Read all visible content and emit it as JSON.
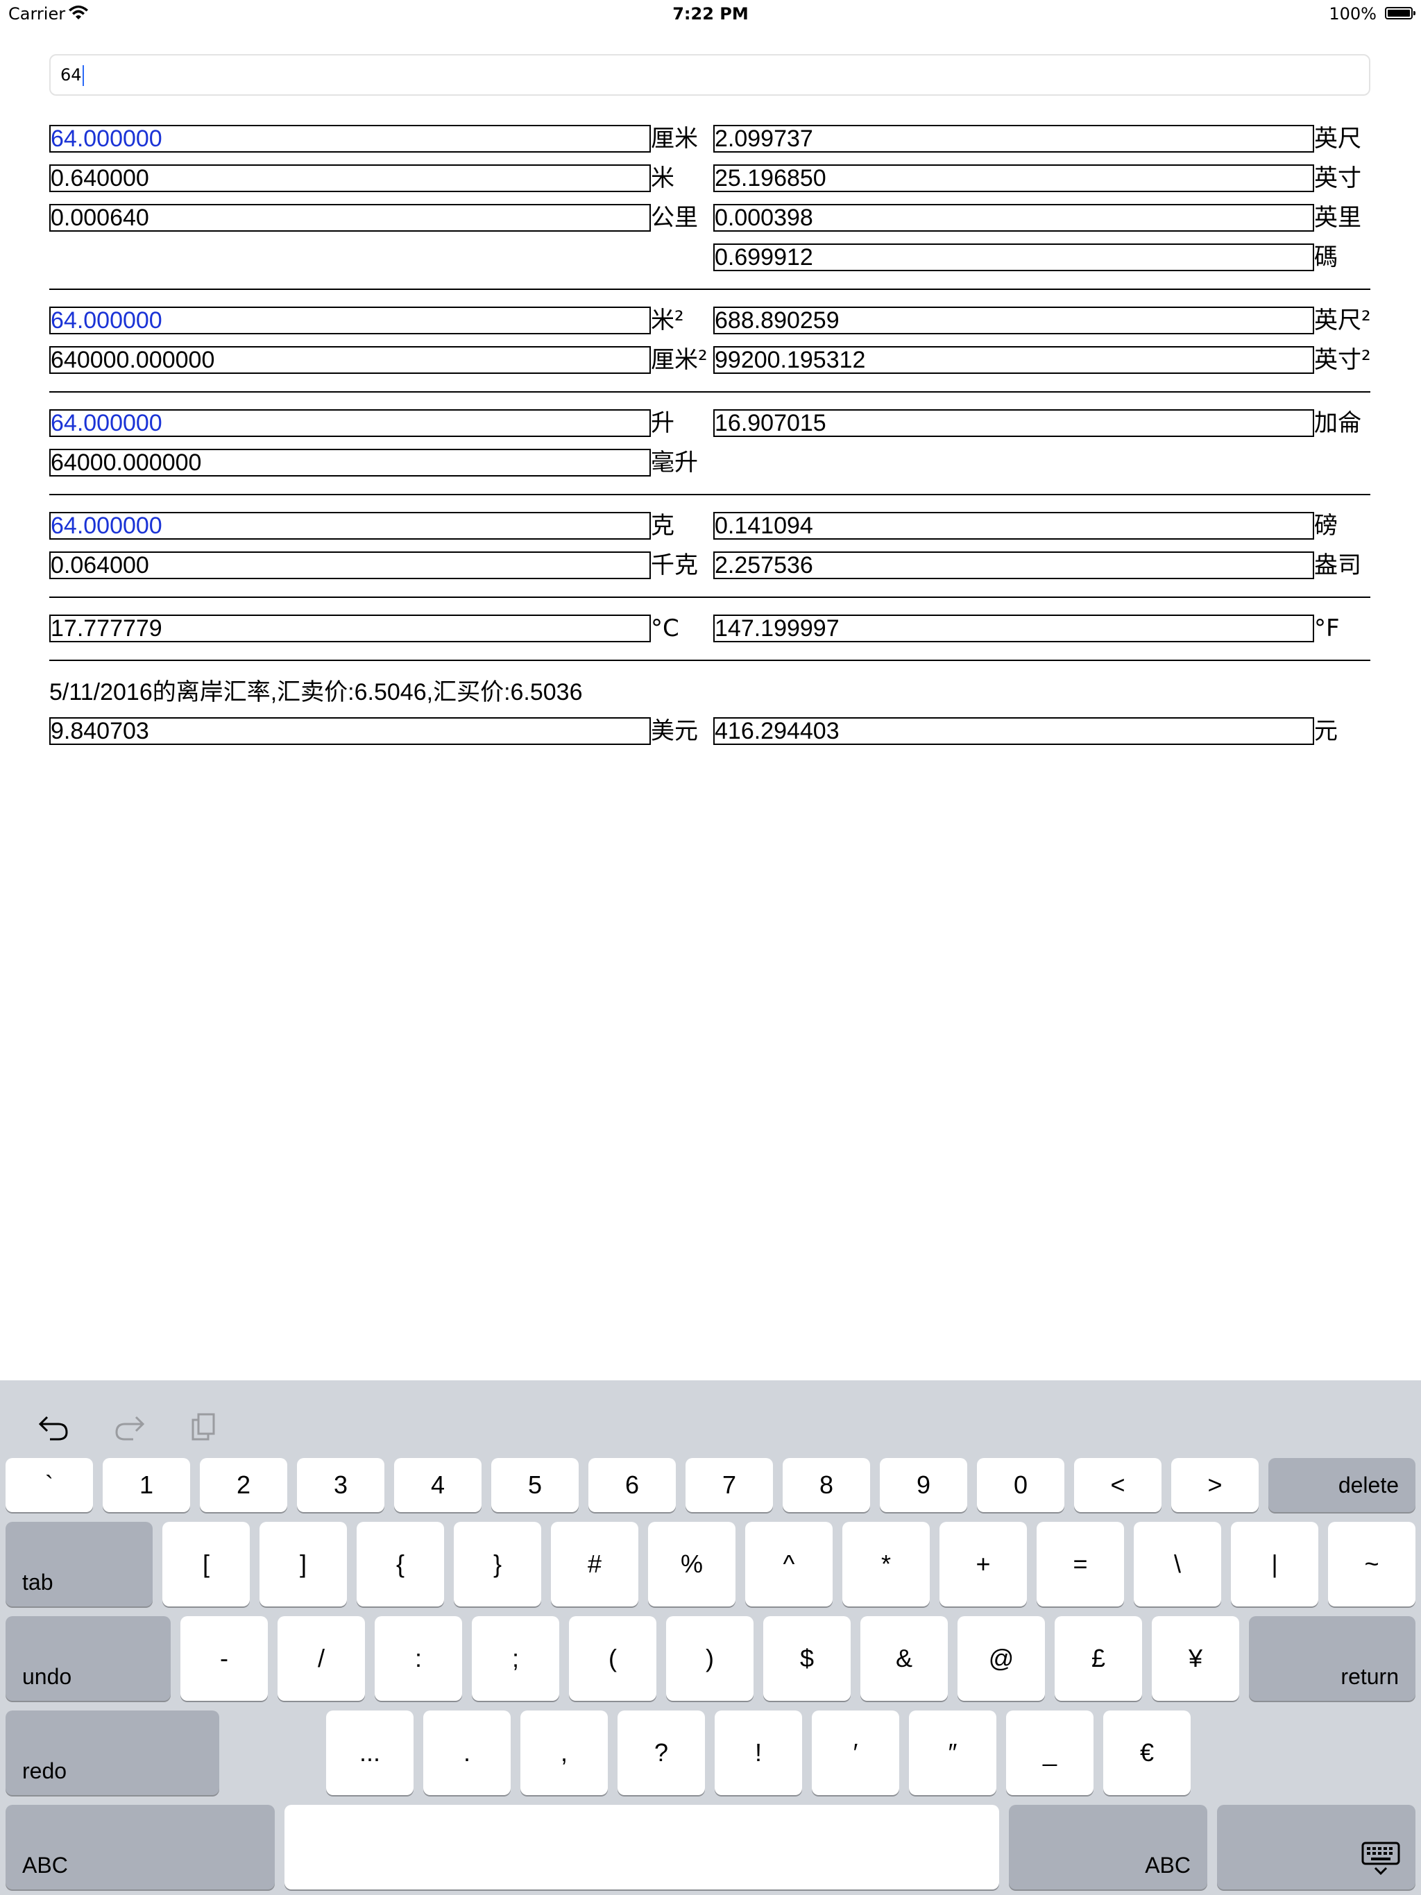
{
  "status_bar": {
    "carrier": "Carrier",
    "time": "7:22 PM",
    "battery": "100%"
  },
  "input": {
    "value": "64"
  },
  "length": {
    "left": [
      {
        "value": "64.000000",
        "unit": "厘米"
      },
      {
        "value": "0.640000",
        "unit": "米"
      },
      {
        "value": "0.000640",
        "unit": "公里"
      }
    ],
    "right": [
      {
        "value": "2.099737",
        "unit": "英尺"
      },
      {
        "value": "25.196850",
        "unit": "英寸"
      },
      {
        "value": "0.000398",
        "unit": "英里"
      },
      {
        "value": "0.699912",
        "unit": "碼"
      }
    ]
  },
  "area": {
    "left": [
      {
        "value": "64.000000",
        "unit": "米²"
      },
      {
        "value": "640000.000000",
        "unit": "厘米²"
      }
    ],
    "right": [
      {
        "value": "688.890259",
        "unit": "英尺²"
      },
      {
        "value": "99200.195312",
        "unit": "英寸²"
      }
    ]
  },
  "volume": {
    "left": [
      {
        "value": "64.000000",
        "unit": "升"
      },
      {
        "value": "64000.000000",
        "unit": "毫升"
      }
    ],
    "right": [
      {
        "value": "16.907015",
        "unit": "加侖"
      }
    ]
  },
  "weight": {
    "left": [
      {
        "value": "64.000000",
        "unit": "克"
      },
      {
        "value": "0.064000",
        "unit": "千克"
      }
    ],
    "right": [
      {
        "value": "0.141094",
        "unit": "磅"
      },
      {
        "value": "2.257536",
        "unit": "盎司"
      }
    ]
  },
  "temperature": {
    "left": {
      "value": "17.777779",
      "unit": "°C"
    },
    "right": {
      "value": "147.199997",
      "unit": "°F"
    }
  },
  "currency": {
    "rate_text": "5/11/2016的离岸汇率,汇卖价:6.5046,汇买价:6.5036",
    "left": {
      "value": "9.840703",
      "unit": "美元"
    },
    "right": {
      "value": "416.294403",
      "unit": "元"
    }
  },
  "keyboard": {
    "toolbar_icons": [
      "undo-icon",
      "redo-icon",
      "paste-icon"
    ],
    "row1": [
      "`",
      "1",
      "2",
      "3",
      "4",
      "5",
      "6",
      "7",
      "8",
      "9",
      "0",
      "<",
      ">"
    ],
    "delete": "delete",
    "tab": "tab",
    "row2": [
      "[",
      "]",
      "{",
      "}",
      "#",
      "%",
      "^",
      "*",
      "+",
      "=",
      "\\",
      "|",
      "~"
    ],
    "undo": "undo",
    "row3": [
      "-",
      "/",
      ":",
      ";",
      "(",
      ")",
      "$",
      "&",
      "@",
      "£",
      "¥"
    ],
    "return": "return",
    "redo": "redo",
    "row4": [
      "...",
      ".",
      ",",
      "?",
      "!",
      "′",
      "″",
      "_",
      "€"
    ],
    "abc_left": "ABC",
    "abc_right": "ABC",
    "dismiss_icon": "keyboard-dismiss-icon"
  }
}
